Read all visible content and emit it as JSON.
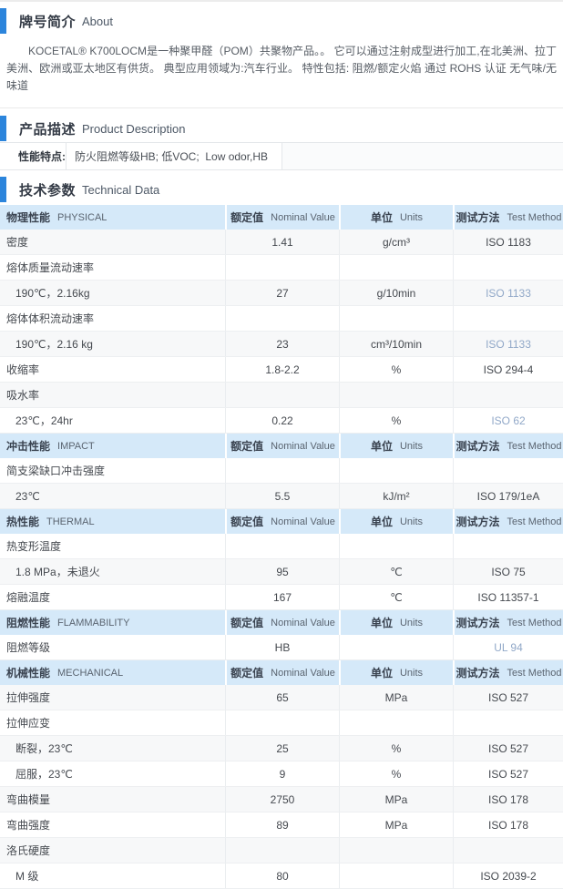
{
  "colors": {
    "accent_blue": "#2c85dc",
    "table_header_bg": "#d5e9f9",
    "method_link_blue": "#91a8c8"
  },
  "sections": {
    "about": {
      "title_zh": "牌号简介",
      "title_en": "About",
      "paragraph": "KOCETAL® K700LOCM是一种聚甲醛（POM）共聚物产品。。 它可以通过注射成型进行加工,在北美洲、拉丁美洲、欧洲或亚太地区有供货。 典型应用领域为:汽车行业。 特性包括: 阻燃/额定火焰 通过 ROHS 认证 无气味/无味道"
    },
    "product_description": {
      "title_zh": "产品描述",
      "title_en": "Product Description",
      "feature_label": "性能特点:",
      "feature_value": "防火阻燃等级HB; 低VOC;  Low odor,HB"
    },
    "technical_data": {
      "title_zh": "技术参数",
      "title_en": "Technical Data"
    }
  },
  "table": {
    "col_headers": {
      "value_zh": "额定值",
      "value_en": "Nominal Value",
      "units_zh": "单位",
      "units_en": "Units",
      "method_zh": "测试方法",
      "method_en": "Test Method"
    },
    "groups": [
      {
        "name_zh": "物理性能",
        "name_en": "PHYSICAL",
        "rows": [
          {
            "name": "密度",
            "indent": false,
            "value": "1.41",
            "units": "g/cm³",
            "method": "ISO 1183",
            "method_link": false,
            "shaded": true
          },
          {
            "name": "熔体质量流动速率",
            "indent": false,
            "value": "",
            "units": "",
            "method": "",
            "method_link": false,
            "shaded": false
          },
          {
            "name": "190℃，2.16kg",
            "indent": true,
            "value": "27",
            "units": "g/10min",
            "method": "ISO 1133",
            "method_link": true,
            "shaded": true
          },
          {
            "name": "熔体体积流动速率",
            "indent": false,
            "value": "",
            "units": "",
            "method": "",
            "method_link": false,
            "shaded": false
          },
          {
            "name": "190℃，2.16 kg",
            "indent": true,
            "value": "23",
            "units": "cm³/10min",
            "method": "ISO 1133",
            "method_link": true,
            "shaded": true
          },
          {
            "name": "收缩率",
            "indent": false,
            "value": "1.8-2.2",
            "units": "%",
            "method": "ISO 294-4",
            "method_link": false,
            "shaded": false
          },
          {
            "name": "吸水率",
            "indent": false,
            "value": "",
            "units": "",
            "method": "",
            "method_link": false,
            "shaded": true
          },
          {
            "name": "23℃，24hr",
            "indent": true,
            "value": "0.22",
            "units": "%",
            "method": "ISO 62",
            "method_link": true,
            "shaded": false
          }
        ]
      },
      {
        "name_zh": "冲击性能",
        "name_en": "IMPACT",
        "rows": [
          {
            "name": "简支梁缺口冲击强度",
            "indent": false,
            "value": "",
            "units": "",
            "method": "",
            "method_link": false,
            "shaded": false
          },
          {
            "name": "23℃",
            "indent": true,
            "value": "5.5",
            "units": "kJ/m²",
            "method": "ISO 179/1eA",
            "method_link": false,
            "shaded": true
          }
        ]
      },
      {
        "name_zh": "热性能",
        "name_en": "THERMAL",
        "rows": [
          {
            "name": "热变形温度",
            "indent": false,
            "value": "",
            "units": "",
            "method": "",
            "method_link": false,
            "shaded": false
          },
          {
            "name": "1.8 MPa，未退火",
            "indent": true,
            "value": "95",
            "units": "℃",
            "method": "ISO 75",
            "method_link": false,
            "shaded": true
          },
          {
            "name": "熔融温度",
            "indent": false,
            "value": "167",
            "units": "℃",
            "method": "ISO 11357-1",
            "method_link": false,
            "shaded": false
          }
        ]
      },
      {
        "name_zh": "阻燃性能",
        "name_en": "FLAMMABILITY",
        "rows": [
          {
            "name": "阻燃等级",
            "indent": false,
            "value": "HB",
            "units": "",
            "method": "UL 94",
            "method_link": true,
            "shaded": false
          }
        ]
      },
      {
        "name_zh": "机械性能",
        "name_en": "MECHANICAL",
        "rows": [
          {
            "name": "拉伸强度",
            "indent": false,
            "value": "65",
            "units": "MPa",
            "method": "ISO 527",
            "method_link": false,
            "shaded": true
          },
          {
            "name": "拉伸应变",
            "indent": false,
            "value": "",
            "units": "",
            "method": "",
            "method_link": false,
            "shaded": false
          },
          {
            "name": "断裂，23℃",
            "indent": true,
            "value": "25",
            "units": "%",
            "method": "ISO 527",
            "method_link": false,
            "shaded": true
          },
          {
            "name": "屈服，23℃",
            "indent": true,
            "value": "9",
            "units": "%",
            "method": "ISO 527",
            "method_link": false,
            "shaded": false
          },
          {
            "name": "弯曲模量",
            "indent": false,
            "value": "2750",
            "units": "MPa",
            "method": "ISO 178",
            "method_link": false,
            "shaded": true
          },
          {
            "name": "弯曲强度",
            "indent": false,
            "value": "89",
            "units": "MPa",
            "method": "ISO 178",
            "method_link": false,
            "shaded": false
          },
          {
            "name": "洛氏硬度",
            "indent": false,
            "value": "",
            "units": "",
            "method": "",
            "method_link": false,
            "shaded": true
          },
          {
            "name": "M 级",
            "indent": true,
            "value": "80",
            "units": "",
            "method": "ISO 2039-2",
            "method_link": false,
            "shaded": false
          }
        ]
      }
    ]
  }
}
